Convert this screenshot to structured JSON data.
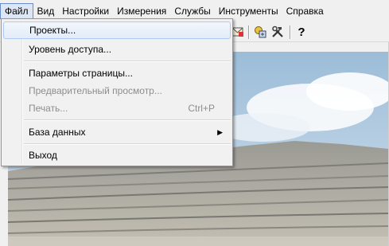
{
  "menubar": {
    "items": [
      "Файл",
      "Вид",
      "Настройки",
      "Измерения",
      "Службы",
      "Инструменты",
      "Справка"
    ]
  },
  "file_menu": {
    "projects": "Проекты...",
    "access_level": "Уровень доступа...",
    "page_setup": "Параметры страницы...",
    "print_preview": "Предварительный просмотр...",
    "print": "Печать...",
    "print_shortcut": "Ctrl+P",
    "database": "База данных",
    "exit": "Выход"
  },
  "toolbar": {
    "help_glyph": "?"
  }
}
